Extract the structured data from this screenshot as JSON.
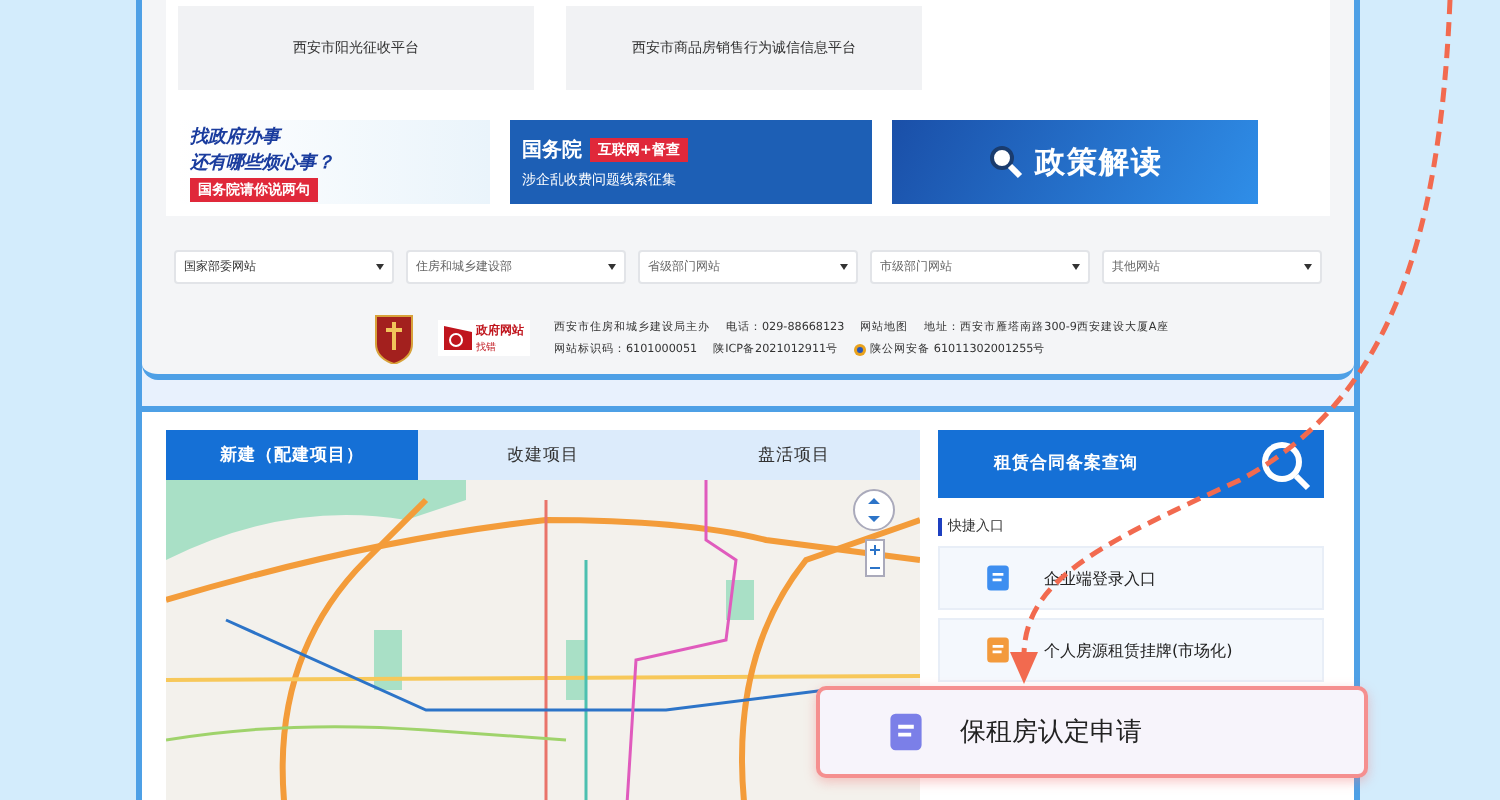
{
  "platforms": [
    "西安市阳光征收平台",
    "西安市商品房销售行为诚信信息平台"
  ],
  "banners": [
    {
      "kind": "service",
      "line_1": "找政府办事",
      "line_2": "还有哪些烦心事？",
      "tag": "国务院请你说两句"
    },
    {
      "kind": "supervision",
      "line_1": "国务院",
      "tag": "互联网+督查",
      "line_2": "涉企乱收费问题线索征集"
    },
    {
      "kind": "policy",
      "line_1": "政策解读"
    }
  ],
  "site_links": [
    "国家部委网站",
    "住房和城乡建设部",
    "省级部门网站",
    "市级部门网站",
    "其他网站"
  ],
  "footer": {
    "gov_badge": "政府网站",
    "gov_badge_sub": "找错",
    "host": "西安市住房和城乡建设局主办",
    "phone": "电话：029-88668123",
    "sitemap": "网站地图",
    "address": "地址：西安市雁塔南路300-9西安建设大厦A座",
    "site_code": "网站标识码：6101000051",
    "icp": "陕ICP备2021012911号",
    "police": "陕公网安备 61011302001255号"
  },
  "map_tabs": [
    {
      "label": "新建（配建项目）",
      "selected": true
    },
    {
      "label": "改建项目",
      "selected": false
    },
    {
      "label": "盘活项目",
      "selected": false
    }
  ],
  "contract_query": "租赁合同备案查询",
  "quick_title": "快捷入口",
  "quick_links": [
    {
      "kind": "link",
      "label": "企业端登录入口",
      "color": "#3d8ef0"
    },
    {
      "kind": "link",
      "label": "个人房源租赁挂牌(市场化)",
      "color": "#f39a3c"
    },
    {
      "kind": "highlighted",
      "label": "保租房认定申请",
      "color": "#7b7fe8"
    }
  ]
}
